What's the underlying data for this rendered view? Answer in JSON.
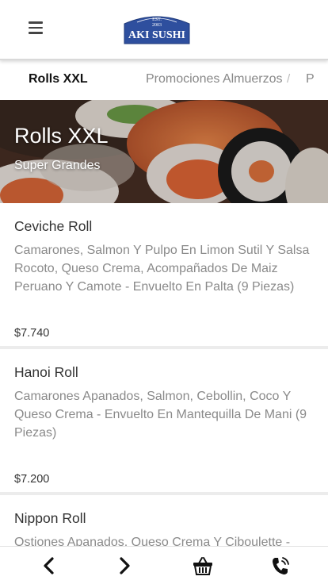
{
  "header": {
    "logo": {
      "line1": "EST.",
      "line2": "2003",
      "name": "AKI SUSHI"
    }
  },
  "tabs": {
    "active": "Rolls XXL",
    "second": "Promociones Almuerzos",
    "separator": "/",
    "third": "P"
  },
  "hero": {
    "title": "Rolls XXL",
    "subtitle": "Super Grandes"
  },
  "products": [
    {
      "name": "Ceviche Roll",
      "description": "Camarones, Salmon Y Pulpo En Limon Sutil Y Salsa Rocoto, Queso Crema, Acompañados De Maiz Peruano Y Camote - Envuelto En Palta (9 Piezas)",
      "price": "$7.740"
    },
    {
      "name": "Hanoi Roll",
      "description": "Camarones Apanados, Salmon, Cebollin, Coco Y Queso Crema - Envuelto En Mantequilla De Mani (9 Piezas)",
      "price": "$7.200"
    },
    {
      "name": "Nippon Roll",
      "description": "Ostiones Apanados, Queso Crema Y Ciboulette -",
      "price": ""
    }
  ],
  "icons": {
    "menu": "hamburger-icon",
    "back": "chevron-left-icon",
    "forward": "chevron-right-icon",
    "cart": "basket-icon",
    "phone": "phone-icon"
  },
  "colors": {
    "logo_bg": "#2e4f9e",
    "active_tab": "#111111",
    "muted_text": "#888888"
  }
}
